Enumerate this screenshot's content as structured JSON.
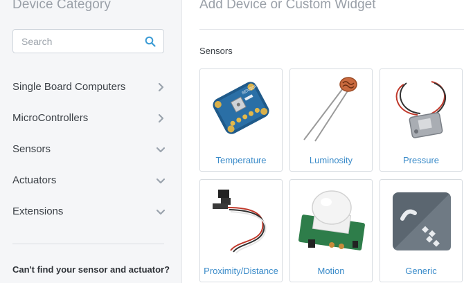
{
  "sidebar": {
    "title": "Device Category",
    "search": {
      "placeholder": "Search",
      "value": ""
    },
    "items": [
      {
        "label": "Single Board Computers",
        "chevron": "chevron-right-icon"
      },
      {
        "label": "MicroControllers",
        "chevron": "chevron-right-icon"
      },
      {
        "label": "Sensors",
        "chevron": "chevron-down-icon"
      },
      {
        "label": "Actuators",
        "chevron": "chevron-down-icon"
      },
      {
        "label": "Extensions",
        "chevron": "chevron-down-icon"
      }
    ],
    "footer": "Can't find your sensor and actuator?"
  },
  "main": {
    "title": "Add Device or Custom Widget",
    "section": "Sensors",
    "cards": [
      {
        "label": "Temperature",
        "icon": "temperature-sensor-board-icon"
      },
      {
        "label": "Luminosity",
        "icon": "photoresistor-icon"
      },
      {
        "label": "Pressure",
        "icon": "pressure-sensor-icon"
      },
      {
        "label": "Proximity/Distance",
        "icon": "proximity-sensor-icon"
      },
      {
        "label": "Motion",
        "icon": "pir-motion-sensor-icon"
      },
      {
        "label": "Generic",
        "icon": "generic-widget-icon"
      }
    ]
  },
  "colors": {
    "accent": "#3a8bc9",
    "sidebar_bg": "#f5f6f8",
    "muted_title": "#9aa0a8",
    "chevron": "#9aa3ad"
  }
}
